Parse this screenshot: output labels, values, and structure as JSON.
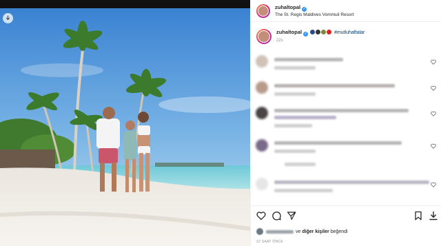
{
  "post": {
    "username": "zuhaltopal",
    "location": "The St. Regis Maldives Vommuli Resort",
    "caption_hashtag": "#mutluhaftalar",
    "caption_time": "22s",
    "liked_by_suffix_pre": "ve",
    "liked_by_others": "diğer kişiler",
    "liked_by_suffix_post": "beğendi",
    "post_age": "22 SAAT ÖNCE"
  },
  "icons": {
    "download": "download-icon",
    "verified": "verified-badge-icon",
    "heart": "heart-icon",
    "comment": "comment-icon",
    "share": "share-icon",
    "save": "bookmark-icon",
    "download_post": "download-icon"
  },
  "colors": {
    "accent_link": "#00376b",
    "verified_blue": "#3897f0",
    "muted_text": "#8e8e8e"
  }
}
